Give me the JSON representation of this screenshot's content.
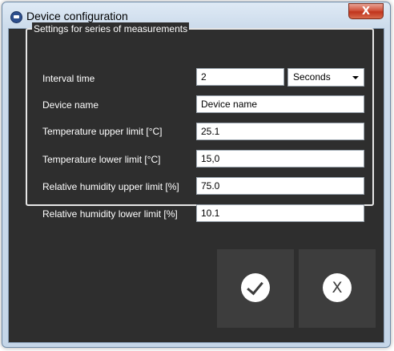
{
  "window": {
    "title": "Device configuration",
    "close_label": "X"
  },
  "group": {
    "title": "Settings for series of measurements"
  },
  "fields": {
    "interval_time": {
      "label": "Interval time",
      "value": "2"
    },
    "interval_unit": {
      "selected": "Seconds"
    },
    "device_name": {
      "label": "Device name",
      "value": "Device name"
    },
    "temp_upper": {
      "label": "Temperature upper limit [°C]",
      "value": "25.1"
    },
    "temp_lower": {
      "label": "Temperature lower limit [°C]",
      "value": "15,0"
    },
    "rh_upper": {
      "label": "Relative humidity upper limit [%]",
      "value": "75.0"
    },
    "rh_lower": {
      "label": "Relative humidity lower limit [%]",
      "value": "10.1"
    }
  },
  "buttons": {
    "ok_icon": "checkmark-icon",
    "cancel_label": "X"
  },
  "colors": {
    "client_background": "#2e2e2e",
    "button_background": "#3d3d3d",
    "close_button": "#c0341c"
  }
}
